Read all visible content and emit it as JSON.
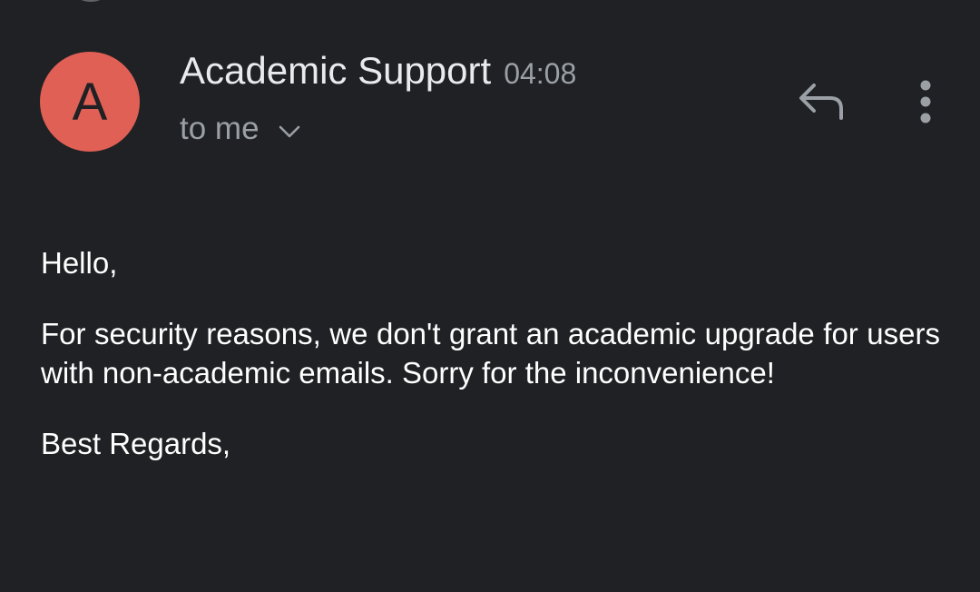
{
  "email": {
    "sender": {
      "avatar_letter": "A",
      "avatar_color": "#e06055",
      "name": "Academic Support",
      "time": "04:08"
    },
    "recipient_label": "to me",
    "actions": {
      "reply_icon": "reply-icon",
      "more_icon": "more-vert-icon",
      "expand_icon": "chevron-down-icon"
    },
    "body": {
      "greeting": "Hello,",
      "message": "For security reasons, we don't grant an academic upgrade for users with non-academic emails. Sorry for the inconvenience!",
      "signoff": "Best Regards,"
    }
  },
  "theme": {
    "background": "#202124",
    "primary_text": "#e8eaed",
    "secondary_text": "#9aa0a6",
    "icon_color": "#9aa0a6"
  }
}
